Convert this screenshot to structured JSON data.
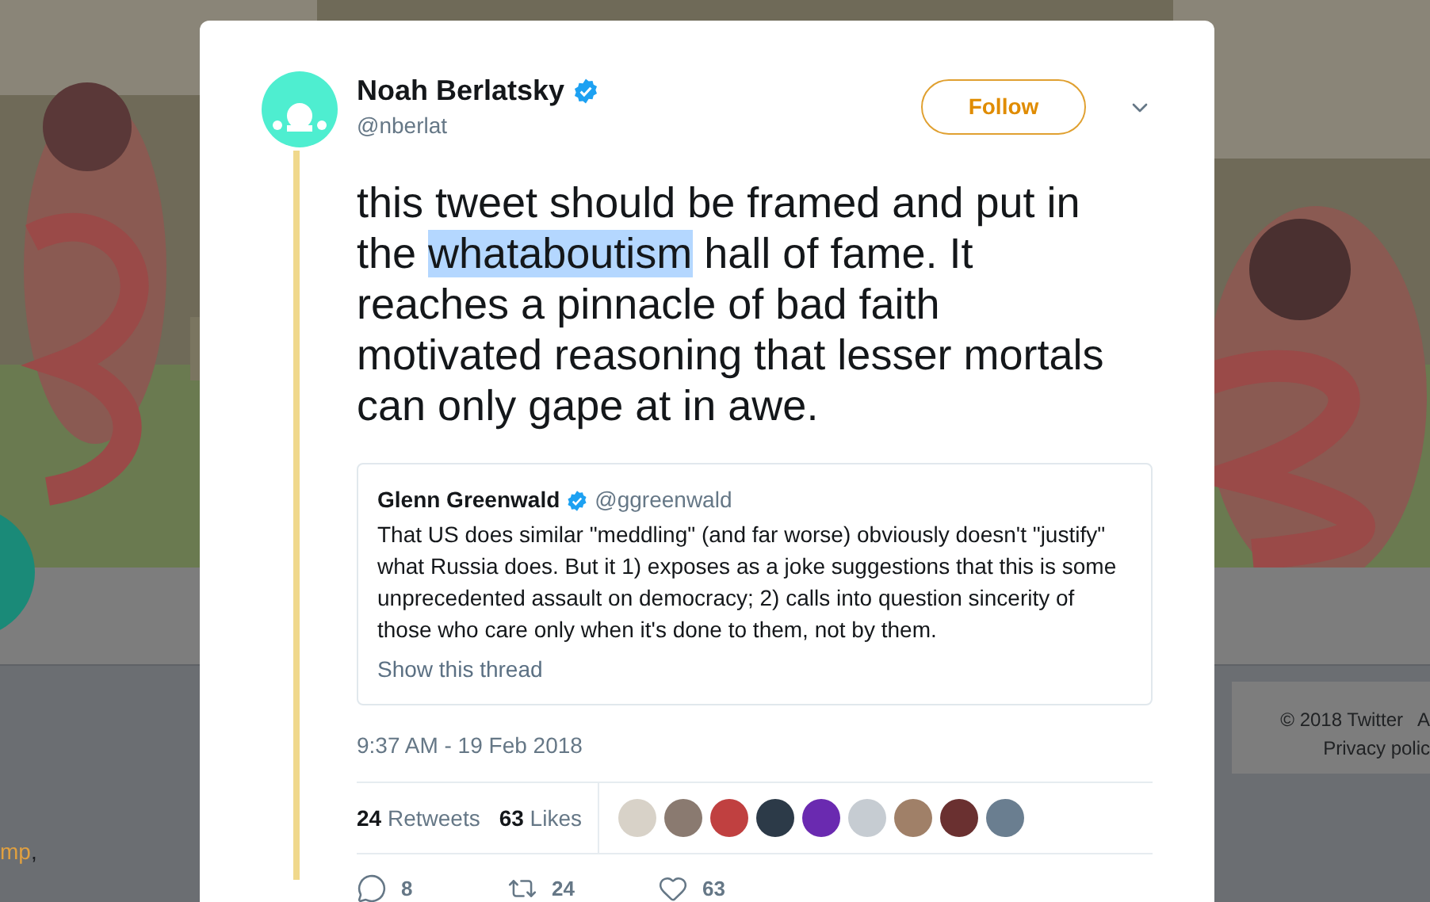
{
  "background": {
    "fragment": {
      "link": "mp",
      "rest": ","
    },
    "footer": {
      "line_1": [
        "© 2018 Twitter",
        "A"
      ],
      "line_2": "Privacy polic"
    }
  },
  "user": {
    "name": "Noah Berlatsky",
    "handle": "@nberlat",
    "verified": true
  },
  "follow_button": "Follow",
  "tweet": [
    {
      "text": "this tweet should be framed and put in the ",
      "highlighted": false
    },
    {
      "text": "whataboutism",
      "highlighted": true
    },
    {
      "text": " hall of fame. It reaches a pinnacle of bad faith motivated reasoning that lesser mortals can only gape at in awe.",
      "highlighted": false
    }
  ],
  "quoted": {
    "name": "Glenn Greenwald",
    "verified": true,
    "handle": "@ggreenwald",
    "text": "That US does similar \"meddling\" (and far worse) obviously doesn't \"justify\" what Russia does. But it 1) exposes as a joke suggestions that this is some unprecedented assault on democracy; 2) calls into question sincerity of those who care only when it's done to them, not by them.",
    "link": "Show this thread"
  },
  "timestamp": "9:37 AM - 19 Feb 2018",
  "stats": [
    {
      "count": "24",
      "label": "Retweets"
    },
    {
      "count": "63",
      "label": "Likes"
    }
  ],
  "likers": [
    {
      "color": "#d8d2c8"
    },
    {
      "color": "#8a7a70"
    },
    {
      "color": "#c04040"
    },
    {
      "color": "#2c3a48"
    },
    {
      "color": "#6a2ab0"
    },
    {
      "color": "#c6ccd2"
    },
    {
      "color": "#a08068"
    },
    {
      "color": "#6a3030"
    },
    {
      "color": "#6a7e90"
    }
  ],
  "actions": [
    {
      "kind": "reply",
      "count": "8"
    },
    {
      "kind": "retweet",
      "count": "24"
    },
    {
      "kind": "like",
      "count": "63"
    }
  ]
}
